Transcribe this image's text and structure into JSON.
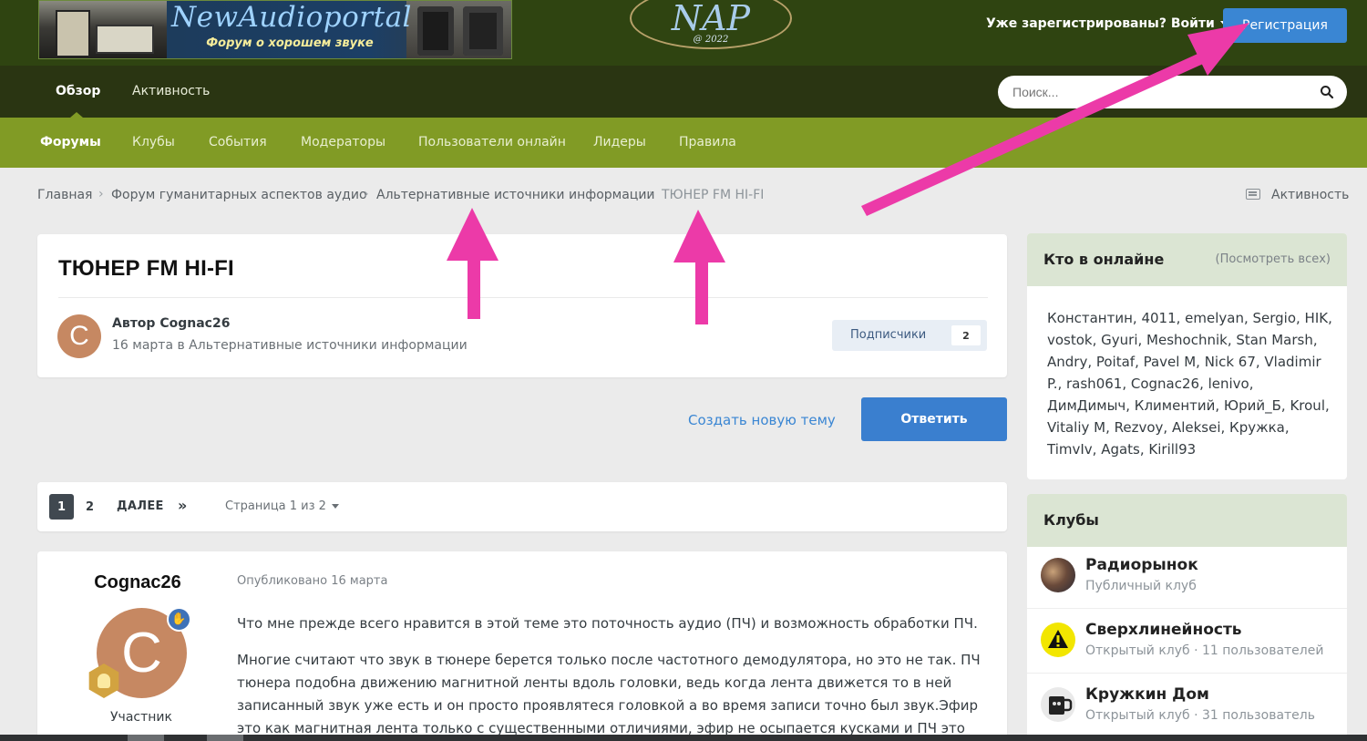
{
  "header": {
    "banner_title": "NewAudioportal",
    "banner_subtitle": "Форум о хорошем звуке",
    "logo_text": "NAP",
    "logo_year": "@ 2022",
    "signin": "Уже зарегистрированы? Войти",
    "register": "Регистрация"
  },
  "nav": {
    "tabs": [
      {
        "label": "Обзор"
      },
      {
        "label": "Активность"
      }
    ],
    "search_placeholder": "Поиск..."
  },
  "subnav": {
    "items": [
      {
        "label": "Форумы"
      },
      {
        "label": "Клубы"
      },
      {
        "label": "События"
      },
      {
        "label": "Модераторы"
      },
      {
        "label": "Пользователи онлайн"
      },
      {
        "label": "Лидеры"
      },
      {
        "label": "Правила"
      }
    ]
  },
  "breadcrumb": {
    "items": [
      {
        "label": "Главная"
      },
      {
        "label": "Форум гуманитарных аспектов аудио"
      },
      {
        "label": "Альтернативные источники информации"
      },
      {
        "label": "ТЮНЕР FM HI-FI"
      }
    ],
    "activity": "Активность"
  },
  "topic": {
    "title": "ТЮНЕР FM HI-FI",
    "avatar_letter": "C",
    "author": "Автор Cognac26",
    "meta": "16 марта в Альтернативные источники информации",
    "followers_label": "Подписчики",
    "followers_count": "2",
    "create_topic": "Создать новую тему",
    "reply": "Ответить"
  },
  "pager": {
    "pages": [
      "1",
      "2"
    ],
    "next": "ДАЛЕЕ",
    "last": "»",
    "jump": "Страница 1 из 2"
  },
  "post": {
    "author": "Cognac26",
    "avatar_letter": "C",
    "role": "Участник",
    "date": "Опубликовано 16 марта",
    "paragraphs": [
      "Что мне прежде всего нравится в этой теме это поточность аудио (ПЧ) и возможность обработки ПЧ.",
      "Многие считают что звук в тюнере берется только после частотного демодулятора, но это не так. ПЧ тюнера подобна движению магнитной ленты вдоль головки, ведь когда лента движется то в ней записанный звук уже есть и он просто проявлятеся головкой а во время записи точно был звук.Эфир это как магнитная лента только с существенными отличиями, эфир не осыпается кусками и ПЧ это"
    ]
  },
  "online": {
    "title": "Кто в онлайне",
    "view_all": "(Посмотреть всех)",
    "users": "Константин, 4011, emelyan, Sergio, HIK, vostok, Gyuri, Meshochnik, Stan Marsh, Andry, Poitaf, Pavel M, Nick 67, Vladimir P., rash061, Cognac26, lenivo, ДимДимыч, Климентий, Юрий_Б, Kroul, Vitaliy M, Rezvoy, Aleksei, Кружка, TimvIv, Agats, Kirill93"
  },
  "clubs": {
    "title": "Клубы",
    "items": [
      {
        "name": "Радиорынок",
        "meta": "Публичный клуб"
      },
      {
        "name": "Сверхлинейность",
        "meta": "Открытый клуб · 11 пользователей"
      },
      {
        "name": "Кружкин Дом",
        "meta": "Открытый клуб · 31 пользователь"
      }
    ]
  },
  "colors": {
    "header_bg": "#2f4411",
    "nav_bg": "#2a3512",
    "subnav_bg": "#819b25",
    "accent_blue": "#3a86d3",
    "annotation_arrow": "#ec3aa8"
  }
}
